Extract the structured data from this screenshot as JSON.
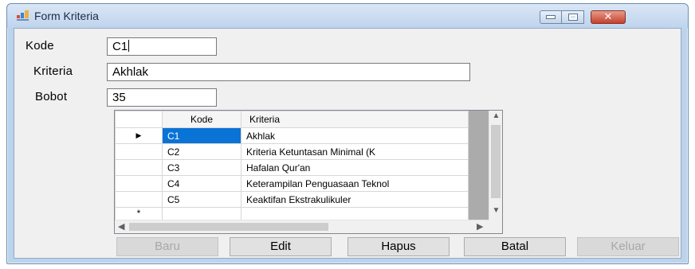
{
  "window": {
    "title": "Form Kriteria",
    "close_glyph": "✕"
  },
  "form": {
    "kode_label": "Kode",
    "kode_value": "C1",
    "kriteria_label": "Kriteria",
    "kriteria_value": "Akhlak",
    "bobot_label": "Bobot",
    "bobot_value": "35"
  },
  "grid": {
    "columns": [
      "Kode",
      "Kriteria"
    ],
    "rows": [
      {
        "kode": "C1",
        "kriteria": "Akhlak",
        "selected": true
      },
      {
        "kode": "C2",
        "kriteria": "Kriteria Ketuntasan Minimal (K"
      },
      {
        "kode": "C3",
        "kriteria": "Hafalan Qur'an"
      },
      {
        "kode": "C4",
        "kriteria": "Keterampilan Penguasaan Teknol"
      },
      {
        "kode": "C5",
        "kriteria": "Keaktifan Ekstrakulikuler"
      }
    ],
    "current_row_glyph": "▶",
    "new_row_glyph": "*"
  },
  "buttons": {
    "baru": "Baru",
    "edit": "Edit",
    "hapus": "Hapus",
    "batal": "Batal",
    "keluar": "Keluar"
  },
  "colors": {
    "selection": "#0a73d6",
    "title_bar": "#bfd4ed",
    "close_button": "#c4422b"
  }
}
